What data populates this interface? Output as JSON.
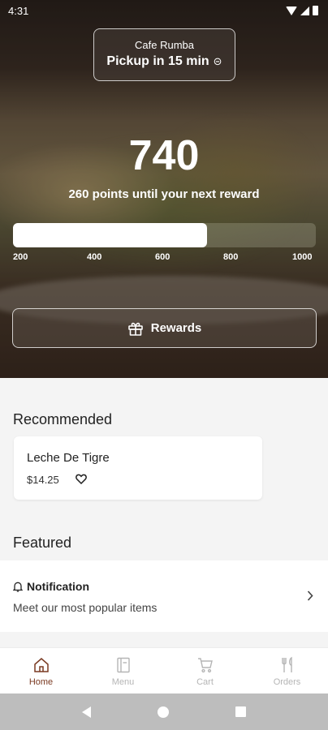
{
  "status_bar": {
    "time": "4:31"
  },
  "store": {
    "name": "Cafe Rumba",
    "pickup": "Pickup in 15 min",
    "pickup_icon": "chevron-circle-down-icon"
  },
  "rewards": {
    "points": "740",
    "message": "260 points until your next reward",
    "progress_fraction": 0.64,
    "ticks": [
      "200",
      "400",
      "600",
      "800",
      "1000"
    ],
    "button_label": "Rewards"
  },
  "recommended": {
    "title": "Recommended",
    "items": [
      {
        "name": "Leche De Tigre",
        "price": "$14.25"
      }
    ]
  },
  "featured": {
    "title": "Featured",
    "notification_title": "Notification",
    "notification_subtitle": "Meet our most popular items"
  },
  "bottom_nav": {
    "items": [
      {
        "label": "Home",
        "icon": "home-icon",
        "active": true
      },
      {
        "label": "Menu",
        "icon": "menu-icon",
        "active": false
      },
      {
        "label": "Cart",
        "icon": "cart-icon",
        "active": false
      },
      {
        "label": "Orders",
        "icon": "fork-knife-icon",
        "active": false
      }
    ]
  },
  "colors": {
    "active_nav": "#7a3a22",
    "inactive_nav": "#b5b5b5",
    "background": "#f4f4f4"
  }
}
